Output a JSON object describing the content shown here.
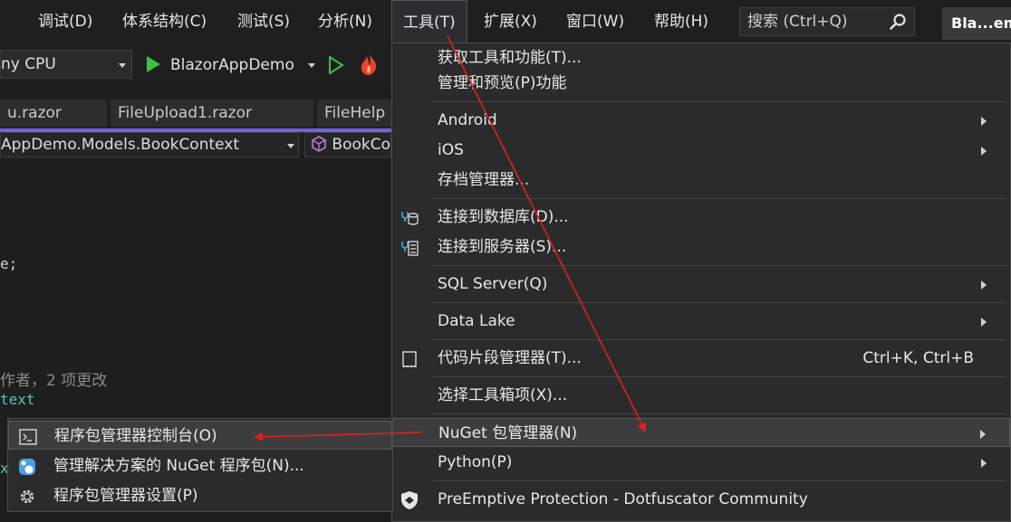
{
  "menubar": {
    "items": [
      "调试(D)",
      "体系结构(C)",
      "测试(S)",
      "分析(N)",
      "工具(T)",
      "扩展(X)",
      "窗口(W)",
      "帮助(H)"
    ],
    "search_label": "搜索 (Ctrl+Q)",
    "title_tab": "Bla...em"
  },
  "toolbar": {
    "platform": "ny CPU",
    "run_target": "BlazorAppDemo"
  },
  "tabs": [
    "u.razor",
    "FileUpload1.razor",
    "FileHelp"
  ],
  "navbar": {
    "scope": "AppDemo.Models.BookContext",
    "member": "BookCo"
  },
  "editor": {
    "lines": [
      "e;",
      "作者，2 项更改",
      "text",
      "x"
    ]
  },
  "tools_menu": {
    "items": [
      {
        "label": "获取工具和功能(T)...",
        "submenu": false,
        "shortcut": ""
      },
      {
        "label": "管理和预览(P)功能",
        "submenu": false,
        "shortcut": ""
      },
      {
        "label": "Android",
        "submenu": true,
        "shortcut": ""
      },
      {
        "label": "iOS",
        "submenu": true,
        "shortcut": ""
      },
      {
        "label": "存档管理器...",
        "submenu": false,
        "shortcut": ""
      },
      {
        "label": "连接到数据库(D)...",
        "submenu": false,
        "shortcut": "",
        "icon": "database-connect-icon"
      },
      {
        "label": "连接到服务器(S)...",
        "submenu": false,
        "shortcut": "",
        "icon": "server-connect-icon"
      },
      {
        "label": "SQL Server(Q)",
        "submenu": true,
        "shortcut": ""
      },
      {
        "label": "Data Lake",
        "submenu": true,
        "shortcut": ""
      },
      {
        "label": "代码片段管理器(T)...",
        "submenu": false,
        "shortcut": "Ctrl+K, Ctrl+B",
        "icon": "snippet-icon"
      },
      {
        "label": "选择工具箱项(X)...",
        "submenu": false,
        "shortcut": ""
      },
      {
        "label": "NuGet 包管理器(N)",
        "submenu": true,
        "shortcut": ""
      },
      {
        "label": "Python(P)",
        "submenu": true,
        "shortcut": ""
      },
      {
        "label": "PreEmptive Protection - Dotfuscator Community",
        "submenu": false,
        "shortcut": "",
        "icon": "shield-icon"
      }
    ]
  },
  "nuget_submenu": {
    "items": [
      {
        "label": "程序包管理器控制台(O)",
        "icon": "console-icon"
      },
      {
        "label": "管理解决方案的 NuGet 程序包(N)...",
        "icon": "nuget-icon"
      },
      {
        "label": "程序包管理器设置(P)",
        "icon": "gear-icon"
      }
    ]
  },
  "colors": {
    "accent": "#7160e8",
    "annotation_arrow": "#e02020",
    "run_green": "#3fbf3f"
  }
}
